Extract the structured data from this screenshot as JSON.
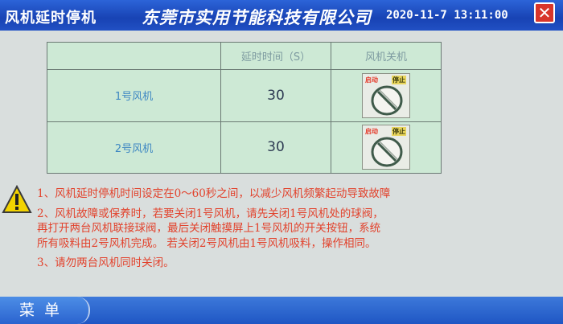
{
  "header": {
    "screen_title": "风机延时停机",
    "company": "东莞市实用节能科技有限公司",
    "datetime": "2020-11-7 13:11:00",
    "close_symbol": "✕"
  },
  "table": {
    "columns": [
      "",
      "延时时间（S）",
      "风机关机"
    ],
    "rows": [
      {
        "name": "1号风机",
        "delay": "30",
        "start_label": "启动",
        "stop_label": "停止"
      },
      {
        "name": "2号风机",
        "delay": "30",
        "start_label": "启动",
        "stop_label": "停止"
      }
    ]
  },
  "notes": {
    "note1": "1、风机延时停机时间设定在0～60秒之间，以减少风机频繁起动导致故障",
    "note2_line1": "2、风机故障或保养时，若要关闭1号风机，请先关闭1号风机处的球阀，",
    "note2_line2": "再打开两台风机联接球阀，最后关闭触摸屏上1号风机的开关按钮，系统",
    "note2_line3": "所有吸料由2号风机完成。    若关闭2号风机由1号风机吸料，操作相同。",
    "note3": "3、请勿两台风机同时关闭。"
  },
  "footer": {
    "menu_label": "菜单"
  },
  "colors": {
    "header_blue": "#1843b4",
    "table_green": "#cde9d5",
    "note_red": "#e2422c",
    "warning_yellow": "#f2d300"
  }
}
